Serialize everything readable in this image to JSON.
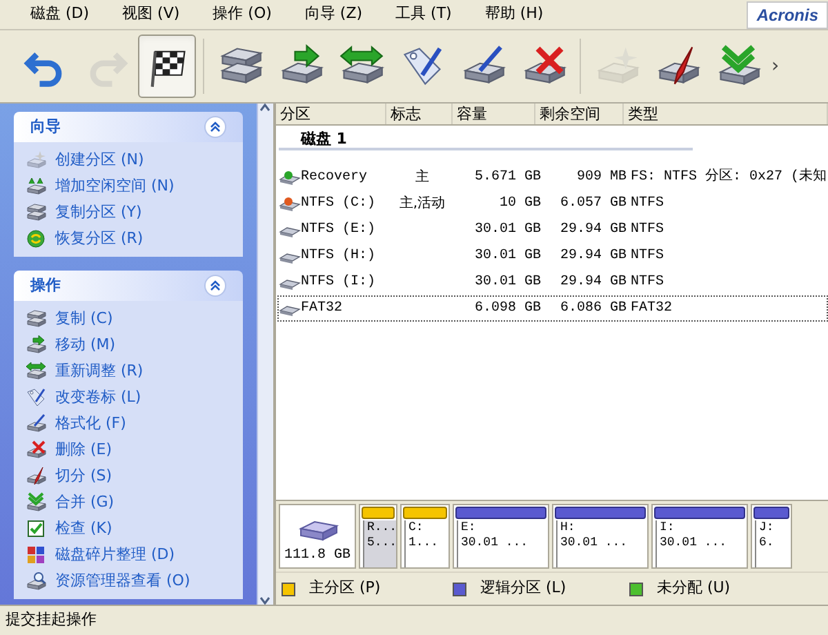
{
  "menu": [
    "磁盘 (D)",
    "视图 (V)",
    "操作 (O)",
    "向导 (Z)",
    "工具 (T)",
    "帮助 (H)"
  ],
  "logo": "Acronis",
  "toolbar": [
    {
      "kind": "undo",
      "disabled": false,
      "pressed": false
    },
    {
      "kind": "redo",
      "disabled": true,
      "pressed": false
    },
    {
      "kind": "commit",
      "disabled": false,
      "pressed": true
    },
    {
      "kind": "copy",
      "disabled": false,
      "pressed": false
    },
    {
      "kind": "move",
      "disabled": false,
      "pressed": false
    },
    {
      "kind": "resize",
      "disabled": false,
      "pressed": false
    },
    {
      "kind": "label",
      "disabled": false,
      "pressed": false
    },
    {
      "kind": "format",
      "disabled": false,
      "pressed": false
    },
    {
      "kind": "delete",
      "disabled": false,
      "pressed": false
    },
    {
      "kind": "create",
      "disabled": true,
      "pressed": false
    },
    {
      "kind": "split",
      "disabled": false,
      "pressed": false
    },
    {
      "kind": "merge",
      "disabled": false,
      "pressed": false
    }
  ],
  "toolbar_more": "›",
  "sidebar": [
    {
      "title": "向导",
      "expanded": true,
      "items": [
        {
          "kind": "create",
          "label": "创建分区 (N)"
        },
        {
          "kind": "addspace",
          "label": "增加空闲空间 (N)"
        },
        {
          "kind": "copy",
          "label": "复制分区 (Y)"
        },
        {
          "kind": "recover",
          "label": "恢复分区 (R)"
        }
      ]
    },
    {
      "title": "操作",
      "expanded": true,
      "items": [
        {
          "kind": "copy",
          "label": "复制 (C)"
        },
        {
          "kind": "move",
          "label": "移动 (M)"
        },
        {
          "kind": "resize",
          "label": "重新调整 (R)"
        },
        {
          "kind": "label",
          "label": "改变卷标 (L)"
        },
        {
          "kind": "format",
          "label": "格式化 (F)"
        },
        {
          "kind": "delete",
          "label": "删除 (E)"
        },
        {
          "kind": "split",
          "label": "切分 (S)"
        },
        {
          "kind": "merge",
          "label": "合并 (G)"
        },
        {
          "kind": "check",
          "label": "检查 (K)"
        },
        {
          "kind": "defrag",
          "label": "磁盘碎片整理 (D)"
        },
        {
          "kind": "explore",
          "label": "资源管理器查看 (O)"
        }
      ]
    }
  ],
  "table": {
    "columns": [
      "分区",
      "标志",
      "容量",
      "剩余空间",
      "类型"
    ],
    "groups": [
      {
        "title": "磁盘 1",
        "rows": [
          {
            "kind": "recovery",
            "selected": false,
            "cells": [
              "Recovery",
              "主",
              "5.671 GB",
              "909 MB",
              "FS: NTFS 分区: 0x27 (未知"
            ]
          },
          {
            "kind": "system",
            "selected": false,
            "cells": [
              "NTFS (C:)",
              "主,活动",
              "10 GB",
              "6.057 GB",
              "NTFS"
            ]
          },
          {
            "kind": "plain",
            "selected": false,
            "cells": [
              "NTFS (E:)",
              "",
              "30.01 GB",
              "29.94 GB",
              "NTFS"
            ]
          },
          {
            "kind": "plain",
            "selected": false,
            "cells": [
              "NTFS (H:)",
              "",
              "30.01 GB",
              "29.94 GB",
              "NTFS"
            ]
          },
          {
            "kind": "plain",
            "selected": false,
            "cells": [
              "NTFS (I:)",
              "",
              "30.01 GB",
              "29.94 GB",
              "NTFS"
            ]
          },
          {
            "kind": "plain",
            "selected": true,
            "cells": [
              "FAT32",
              "",
              "6.098 GB",
              "6.086 GB",
              "FAT32"
            ]
          }
        ]
      }
    ]
  },
  "disk_map": {
    "size": "111.8 GB",
    "partitions": [
      {
        "kind": "primary",
        "selected": true,
        "line1": "R...",
        "line2": "5..."
      },
      {
        "kind": "primary",
        "selected": false,
        "line1": "C:",
        "line2": "1..."
      },
      {
        "kind": "logical",
        "selected": false,
        "line1": "E:",
        "line2": "30.01 ..."
      },
      {
        "kind": "logical",
        "selected": false,
        "line1": "H:",
        "line2": "30.01 ..."
      },
      {
        "kind": "logical",
        "selected": false,
        "line1": "I:",
        "line2": "30.01 ..."
      },
      {
        "kind": "logical",
        "selected": false,
        "line1": "J:",
        "line2": "6."
      }
    ]
  },
  "legend": [
    {
      "label": "主分区 (P)",
      "color": "#f5c400"
    },
    {
      "label": "逻辑分区 (L)",
      "color": "#5a5ad0"
    },
    {
      "label": "未分配 (U)",
      "color": "#4cbf2e"
    }
  ],
  "status_bar": "提交挂起操作"
}
